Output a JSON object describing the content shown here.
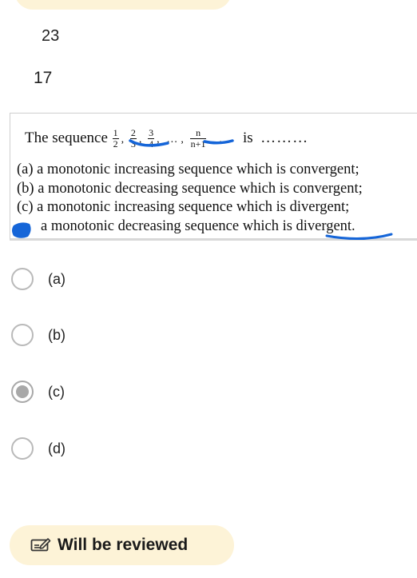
{
  "prev_numbers": [
    "23",
    "17"
  ],
  "question": {
    "prefix": "The sequence",
    "terms": [
      {
        "num": "1",
        "den": "2"
      },
      {
        "num": "2",
        "den": "3"
      },
      {
        "num": "3",
        "den": "4"
      }
    ],
    "ellipsis": "…",
    "general_term": {
      "num": "n",
      "den": "n+1"
    },
    "trailing": "…",
    "suffix": "is",
    "blank": "………",
    "options": [
      "(a) a monotonic increasing sequence which is convergent;",
      "(b) a monotonic decreasing sequence which is convergent;",
      "(c) a monotonic increasing sequence which is divergent;",
      "a monotonic decreasing sequence which is divergent."
    ]
  },
  "answers": [
    {
      "label": "(a)",
      "checked": false
    },
    {
      "label": "(b)",
      "checked": false
    },
    {
      "label": "(c)",
      "checked": true
    },
    {
      "label": "(d)",
      "checked": false
    }
  ],
  "review": {
    "label": "Will be reviewed",
    "icon": "edit-note-icon"
  },
  "colors": {
    "pill": "#fdf3d7",
    "ink": "#1565d8",
    "radio": "#a8a8a8"
  }
}
